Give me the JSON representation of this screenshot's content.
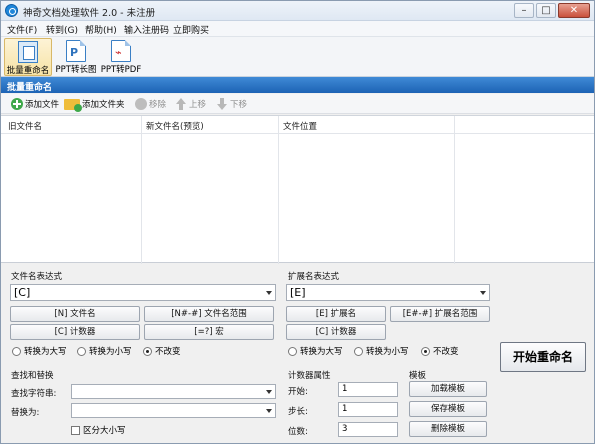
{
  "window": {
    "title": "神奇文档处理软件 2.0 - 未注册"
  },
  "menu": [
    "文件(F)",
    "转到(G)",
    "帮助(H)",
    "输入注册码",
    "立即购买"
  ],
  "big_toolbar": [
    {
      "label": "批量重命名",
      "icon": "batch-rename-icon",
      "active": true
    },
    {
      "label": "PPT转长图",
      "icon": "ppt-to-image-icon",
      "active": false
    },
    {
      "label": "PPT转PDF",
      "icon": "ppt-to-pdf-icon",
      "active": false
    }
  ],
  "section_title": "批量重命名",
  "small_toolbar": {
    "add_file": "添加文件",
    "add_folder": "添加文件夹",
    "remove": "移除",
    "move_up": "上移",
    "move_down": "下移"
  },
  "table": {
    "columns": [
      "旧文件名",
      "新文件名(预览)",
      "文件位置"
    ],
    "rows": []
  },
  "filename_expr": {
    "label": "文件名表达式",
    "value": "[C]",
    "buttons": [
      "[N] 文件名",
      "[N#-#] 文件名范围",
      "[C] 计数器",
      "[=?] 宏"
    ],
    "case_options": [
      "转换为大写",
      "转换为小写",
      "不改变"
    ],
    "case_selected": "不改变"
  },
  "ext_expr": {
    "label": "扩展名表达式",
    "value": "[E]",
    "buttons": [
      "[E] 扩展名",
      "[E#-#] 扩展名范围",
      "[C] 计数器"
    ],
    "case_options": [
      "转换为大写",
      "转换为小写",
      "不改变"
    ],
    "case_selected": "不改变"
  },
  "find_replace": {
    "label": "查找和替换",
    "find_label": "查找字符串:",
    "find_value": "",
    "replace_label": "替换为:",
    "replace_value": "",
    "case_sensitive_label": "区分大小写",
    "case_sensitive": false
  },
  "counter": {
    "label": "计数器属性",
    "start_label": "开始:",
    "start_value": "1",
    "step_label": "步长:",
    "step_value": "1",
    "digits_label": "位数:",
    "digits_value": "3"
  },
  "template": {
    "label": "模板",
    "load": "加载模板",
    "save": "保存模板",
    "delete": "删除模板"
  },
  "start_button": "开始重命名",
  "colors": {
    "header_blue": "#1d63b5",
    "active_tool": "#f6e3a6"
  }
}
